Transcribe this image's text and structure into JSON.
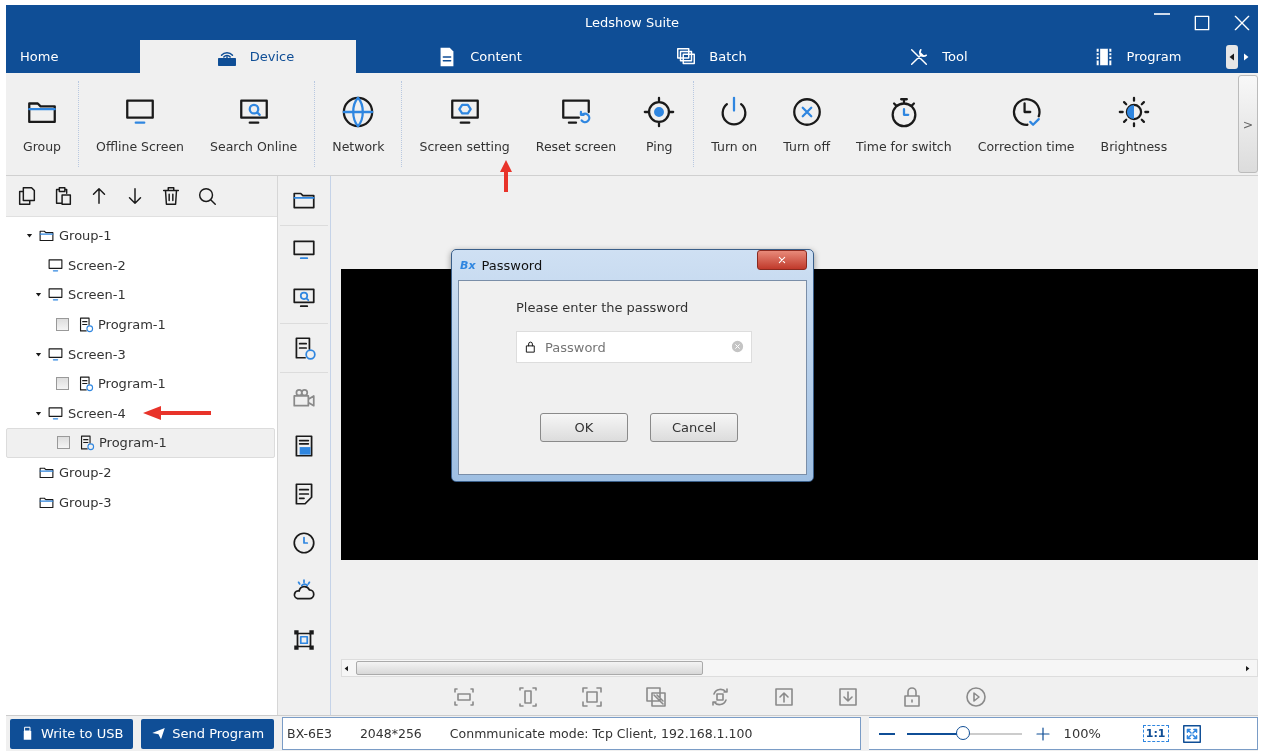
{
  "window": {
    "title": "Ledshow Suite"
  },
  "tabs": [
    {
      "label": "Home",
      "selected": false
    },
    {
      "label": "Device",
      "selected": true
    },
    {
      "label": "Content",
      "selected": false
    },
    {
      "label": "Batch",
      "selected": false
    },
    {
      "label": "Tool",
      "selected": false
    },
    {
      "label": "Program",
      "selected": false
    }
  ],
  "toolbar": {
    "groups": [
      [
        "Group"
      ],
      [
        "Offline Screen",
        "Search Online"
      ],
      [
        "Network"
      ],
      [
        "Screen setting",
        "Reset screen",
        "Ping"
      ],
      [
        "Turn on",
        "Turn off",
        "Time for switch",
        "Correction time",
        "Brightness"
      ]
    ],
    "more": ">"
  },
  "tree": [
    {
      "kind": "group",
      "label": "Group-1",
      "expanded": true,
      "selected": false,
      "children": [
        {
          "kind": "screen",
          "label": "Screen-2",
          "selected": false
        },
        {
          "kind": "screen",
          "label": "Screen-1",
          "expanded": true,
          "selected": false,
          "children": [
            {
              "kind": "program",
              "label": "Program-1",
              "checked": false,
              "selected": false
            }
          ]
        },
        {
          "kind": "screen",
          "label": "Screen-3",
          "expanded": true,
          "selected": false,
          "children": [
            {
              "kind": "program",
              "label": "Program-1",
              "checked": false,
              "selected": false
            }
          ]
        },
        {
          "kind": "screen",
          "label": "Screen-4",
          "expanded": true,
          "selected": false,
          "children": [
            {
              "kind": "program",
              "label": "Program-1",
              "checked": false,
              "selected": true
            }
          ]
        }
      ]
    },
    {
      "kind": "group",
      "label": "Group-2",
      "selected": false
    },
    {
      "kind": "group",
      "label": "Group-3",
      "selected": false
    }
  ],
  "dialog": {
    "logo": "Bx",
    "title": "Password",
    "prompt": "Please enter the password",
    "placeholder": "Password",
    "buttons": [
      "OK",
      "Cancel"
    ]
  },
  "status_bar": {
    "buttons": [
      "Write to USB",
      "Send Program"
    ],
    "device": "BX-6E3",
    "resolution": "2048*256",
    "connection": "Conmmunicate mode: Tcp Client, 192.168.1.100",
    "zoom": {
      "level": 0.5,
      "reading": "100%"
    },
    "actual_size": "1:1"
  }
}
